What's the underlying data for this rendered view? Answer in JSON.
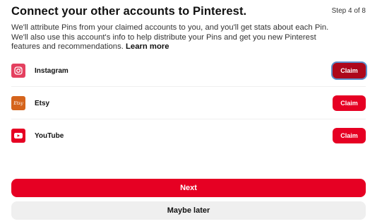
{
  "header": {
    "title": "Connect your other accounts to Pinterest.",
    "step": "Step 4 of 8"
  },
  "description": {
    "line1": "We'll attribute Pins from your claimed accounts to you, and you'll get stats about each Pin.",
    "line2": "We'll also use this account's info to help distribute your Pins and get you new Pinterest",
    "line3": "features and recommendations.",
    "learn_more": "Learn more"
  },
  "accounts": [
    {
      "name": "Instagram",
      "icon": "instagram-icon",
      "color": "#e4405f",
      "claim_label": "Claim",
      "focused": true
    },
    {
      "name": "Etsy",
      "icon": "etsy-icon",
      "icon_text": "Etsy",
      "color": "#d5641c",
      "claim_label": "Claim",
      "focused": false
    },
    {
      "name": "YouTube",
      "icon": "youtube-icon",
      "color": "#e60023",
      "claim_label": "Claim",
      "focused": false
    }
  ],
  "actions": {
    "next_label": "Next",
    "later_label": "Maybe later"
  },
  "colors": {
    "brand_red": "#e60023",
    "claim_focused": "#ad081b",
    "secondary_bg": "#efefef"
  }
}
